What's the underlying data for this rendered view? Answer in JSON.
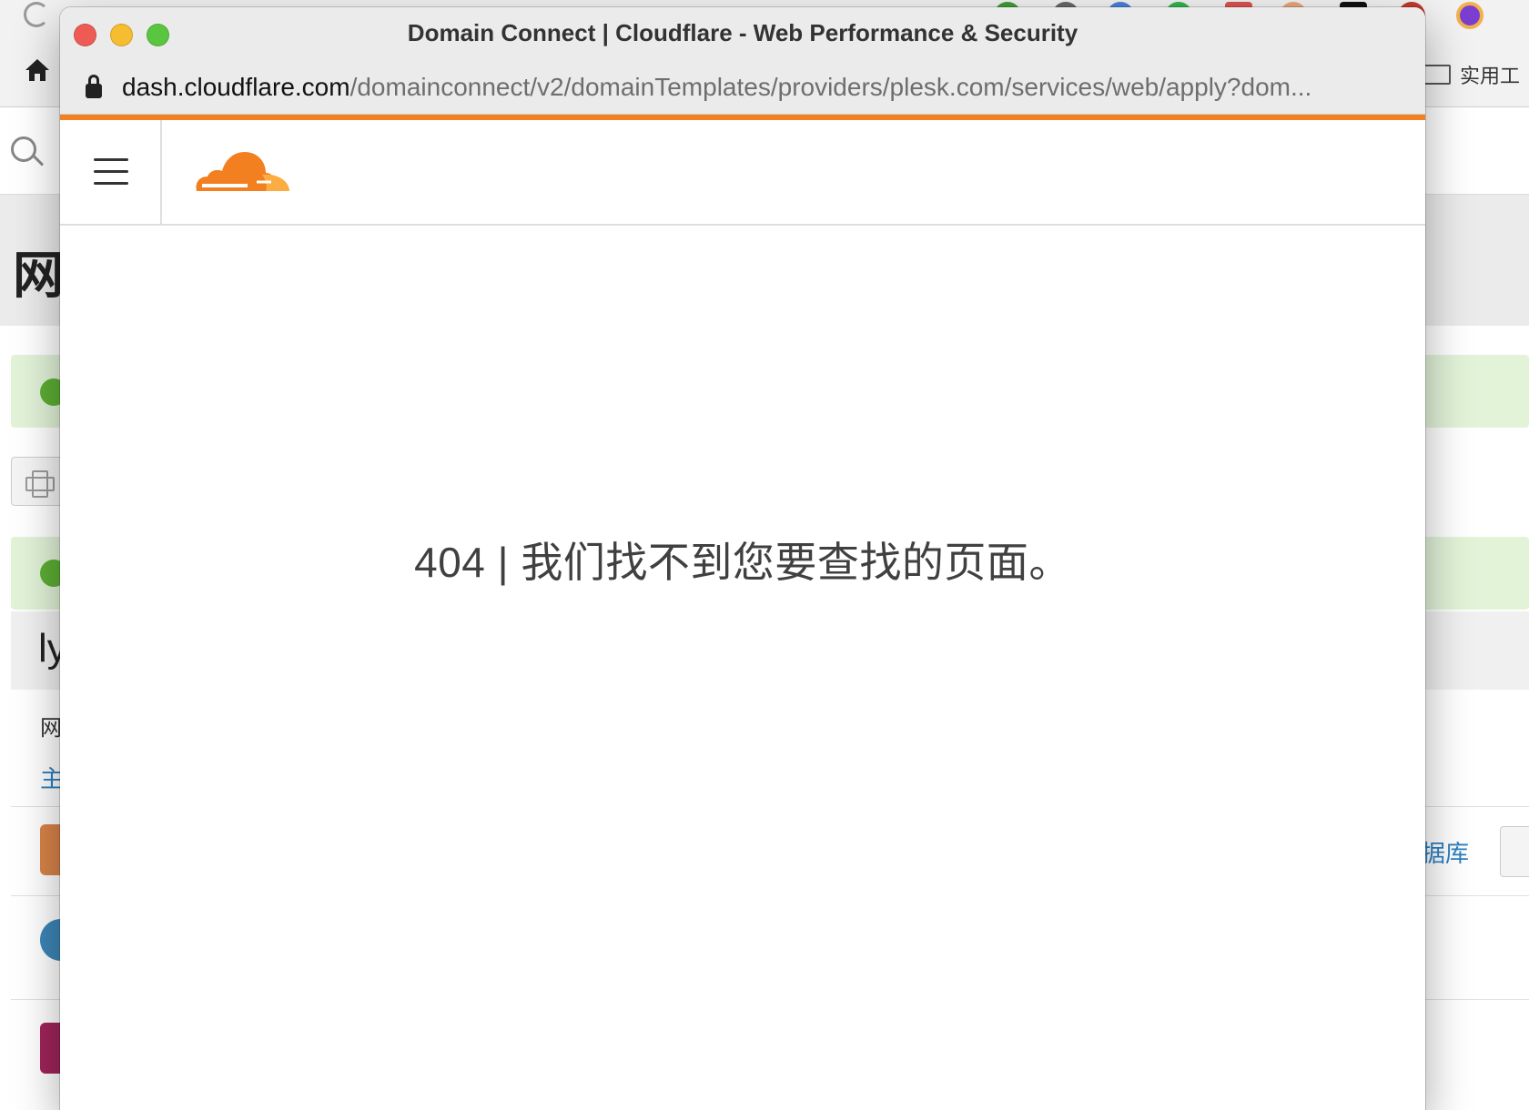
{
  "window": {
    "title": "Domain Connect | Cloudflare - Web Performance & Security"
  },
  "address_bar": {
    "host": "dash.cloudflare.com",
    "path": "/domainconnect/v2/domainTemplates/providers/plesk.com/services/web/apply?dom..."
  },
  "page": {
    "error_message": "404 | 我们找不到您要查找的页面。"
  },
  "background_window": {
    "bookmark_label": "实用工",
    "title_fragment": "网",
    "domain_fragment": "ly",
    "row_fragment": "网",
    "link_fragment": "主",
    "db_link_fragment": "据库"
  },
  "colors": {
    "cloudflare_orange": "#f38020",
    "cloudflare_light_orange": "#fbad41",
    "close": "#ee5b55",
    "minimize": "#f5bd2f",
    "maximize": "#5ac63f",
    "success_background": "#e2f3d8",
    "success_check": "#5daf34"
  },
  "icons": {
    "home": "home-icon",
    "reload": "reload-icon",
    "lock": "lock-icon",
    "menu": "hamburger-menu-icon",
    "logo": "cloudflare-logo"
  }
}
